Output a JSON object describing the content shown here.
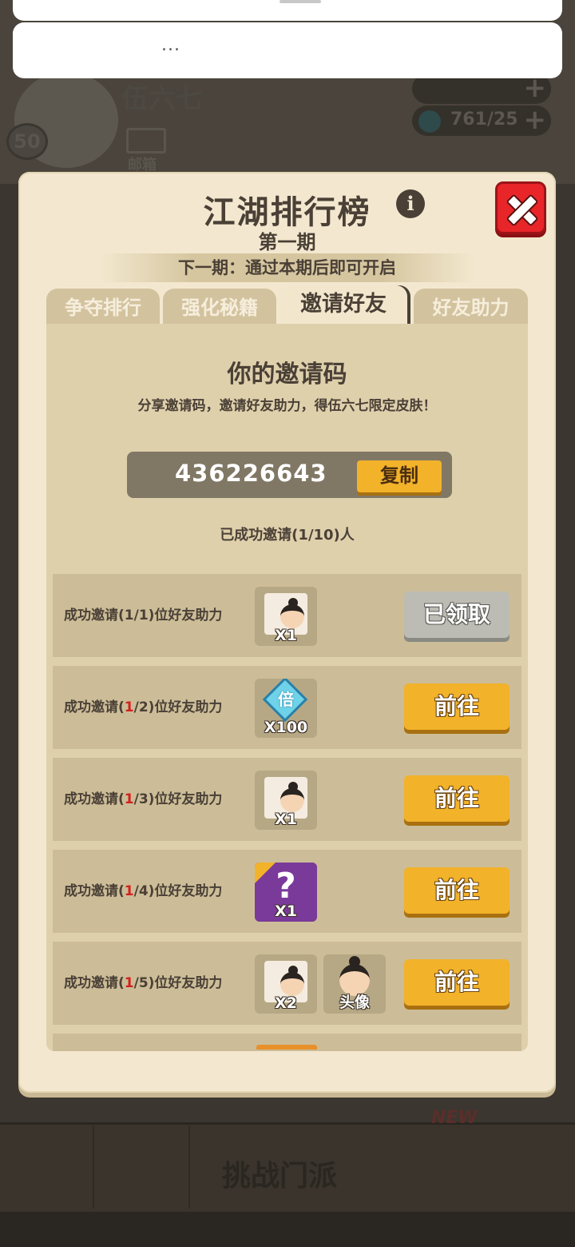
{
  "background": {
    "player_name": "伍六七",
    "level": "50",
    "mail_label": "邮箱",
    "gems": "761/25",
    "challenge_label": "挑战门派",
    "new_badge": "NEW"
  },
  "system_sheet": {
    "menu_dots": "..."
  },
  "modal": {
    "title": "江湖排行榜",
    "period": "第一期",
    "next_period": "下一期：通过本期后即可开启",
    "tabs": [
      {
        "label": "争夺排行"
      },
      {
        "label": "强化秘籍"
      },
      {
        "label": "邀请好友"
      },
      {
        "label": "好友助力"
      }
    ],
    "active_tab": "邀请好友"
  },
  "invite": {
    "title": "你的邀请码",
    "description": "分享邀请码，邀请好友助力，得伍六七限定皮肤！",
    "code": "436226643",
    "copy_label": "复制",
    "invited_count": "已成功邀请(1/10)人"
  },
  "rewards": [
    {
      "prefix": "成功邀请(",
      "done": "1",
      "rest": "/1)位好友助力",
      "done_red": false,
      "items": [
        {
          "icon": "hero-fragment-icon",
          "qty": "X1"
        }
      ],
      "button": "已领取",
      "claimed": true
    },
    {
      "prefix": "成功邀请(",
      "done": "1",
      "rest": "/2)位好友助力",
      "done_red": true,
      "items": [
        {
          "icon": "multiplier-diamond-icon",
          "qty": "X100",
          "glyph": "倍"
        }
      ],
      "button": "前往",
      "claimed": false
    },
    {
      "prefix": "成功邀请(",
      "done": "1",
      "rest": "/3)位好友助力",
      "done_red": true,
      "items": [
        {
          "icon": "hero-fragment-icon",
          "qty": "X1"
        }
      ],
      "button": "前往",
      "claimed": false
    },
    {
      "prefix": "成功邀请(",
      "done": "1",
      "rest": "/4)位好友助力",
      "done_red": true,
      "items": [
        {
          "icon": "mystery-box-icon",
          "qty": "X1",
          "glyph": "?"
        }
      ],
      "button": "前往",
      "claimed": false
    },
    {
      "prefix": "成功邀请(",
      "done": "1",
      "rest": "/5)位好友助力",
      "done_red": true,
      "items": [
        {
          "icon": "hero-fragment-icon",
          "qty": "X2"
        },
        {
          "icon": "avatar-icon",
          "qty": "头像"
        }
      ],
      "button": "前往",
      "claimed": false
    }
  ],
  "colors": {
    "modal_bg": "#f3e8cf",
    "panel_bg": "#dfd0ac",
    "row_bg": "#ccbd98",
    "accent_button": "#f2b22a",
    "claimed_button": "#bcbcb4",
    "close_red": "#e8262a",
    "progress_red": "#d42020"
  }
}
